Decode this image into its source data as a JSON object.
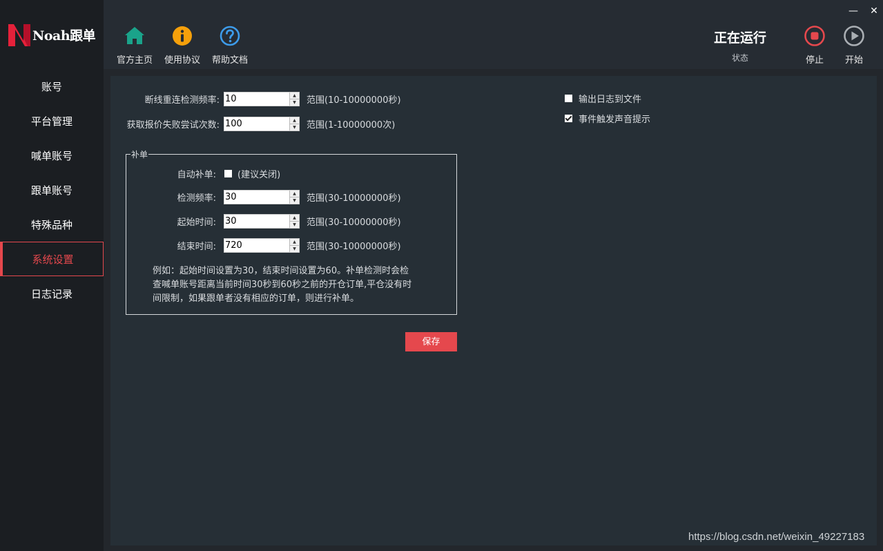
{
  "app": {
    "logo_text": "Noah跟单"
  },
  "sidebar": {
    "items": [
      {
        "label": "账号"
      },
      {
        "label": "平台管理"
      },
      {
        "label": "喊单账号"
      },
      {
        "label": "跟单账号"
      },
      {
        "label": "特殊品种"
      },
      {
        "label": "系统设置",
        "active": true
      },
      {
        "label": "日志记录"
      }
    ]
  },
  "toolbar": {
    "home_label": "官方主页",
    "agreement_label": "使用协议",
    "help_label": "帮助文档",
    "status_value": "正在运行",
    "status_label": "状态",
    "stop_label": "停止",
    "start_label": "开始"
  },
  "window": {
    "minimize": "—",
    "close": "✕"
  },
  "settings": {
    "reconnect": {
      "label": "断线重连检测频率:",
      "value": "10",
      "range": "范围(10-10000000秒)"
    },
    "retry": {
      "label": "获取报价失败尝试次数:",
      "value": "100",
      "range": "范围(1-10000000次)"
    },
    "log_to_file": {
      "label": "输出日志到文件",
      "checked": false
    },
    "sound_alert": {
      "label": "事件触发声音提示",
      "checked": true
    }
  },
  "supplement": {
    "title": "补单",
    "auto": {
      "label": "自动补单:",
      "hint": "(建议关闭)",
      "checked": false
    },
    "interval": {
      "label": "检测频率:",
      "value": "30",
      "range": "范围(30-10000000秒)"
    },
    "start_time": {
      "label": "起始时间:",
      "value": "30",
      "range": "范围(30-10000000秒)"
    },
    "end_time": {
      "label": "结束时间:",
      "value": "720",
      "range": "范围(30-10000000秒)"
    },
    "note_line1": "例如：起始时间设置为30，结束时间设置为60。补单检测时会检",
    "note_line2": "查喊单账号距离当前时间30秒到60秒之前的开仓订单,平仓没有时",
    "note_line3": "间限制，如果跟单者没有相应的订单，则进行补单。"
  },
  "actions": {
    "save_label": "保存"
  },
  "watermark": "https://blog.csdn.net/weixin_49227183",
  "colors": {
    "accent": "#e5484d",
    "home_icon": "#1aa38a",
    "info_icon": "#f5a00b",
    "help_icon": "#3d9be9"
  }
}
